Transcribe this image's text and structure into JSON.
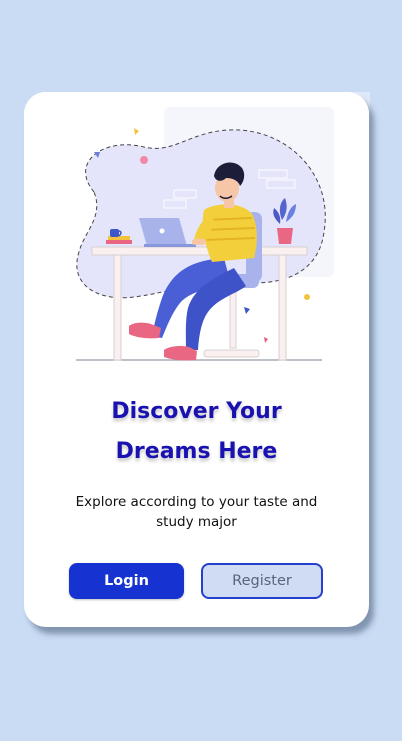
{
  "onboarding": {
    "title_line1": "Discover Your",
    "title_line2": "Dreams Here",
    "subtitle_line1": "Explore according to your taste and",
    "subtitle_line2": "study major",
    "login_label": "Login",
    "register_label": "Register"
  },
  "colors": {
    "background": "#cadcf4",
    "card": "#ffffff",
    "title": "#1a12b0",
    "login_button": "#1633d2",
    "register_button": "#cfdcf4",
    "register_border": "#2440cc"
  },
  "icons": [
    "person-at-desk-illustration"
  ]
}
